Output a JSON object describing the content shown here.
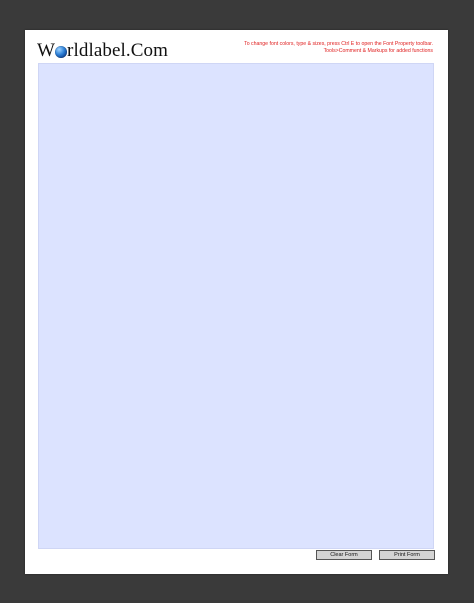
{
  "logo": {
    "prefix": "W",
    "suffix": "rldlabel.Com"
  },
  "instructions": {
    "line1": "To change font colors, type & sizes, press Ctrl E to open the Font Property toolbar.",
    "line2": "Tools>Comment & Markups for added functions"
  },
  "buttons": {
    "clear_label": "Clear Form",
    "print_label": "Print Form"
  },
  "colors": {
    "label_area": "#dce3ff",
    "instruction_text": "#e02020",
    "background": "#3a3a3a"
  }
}
